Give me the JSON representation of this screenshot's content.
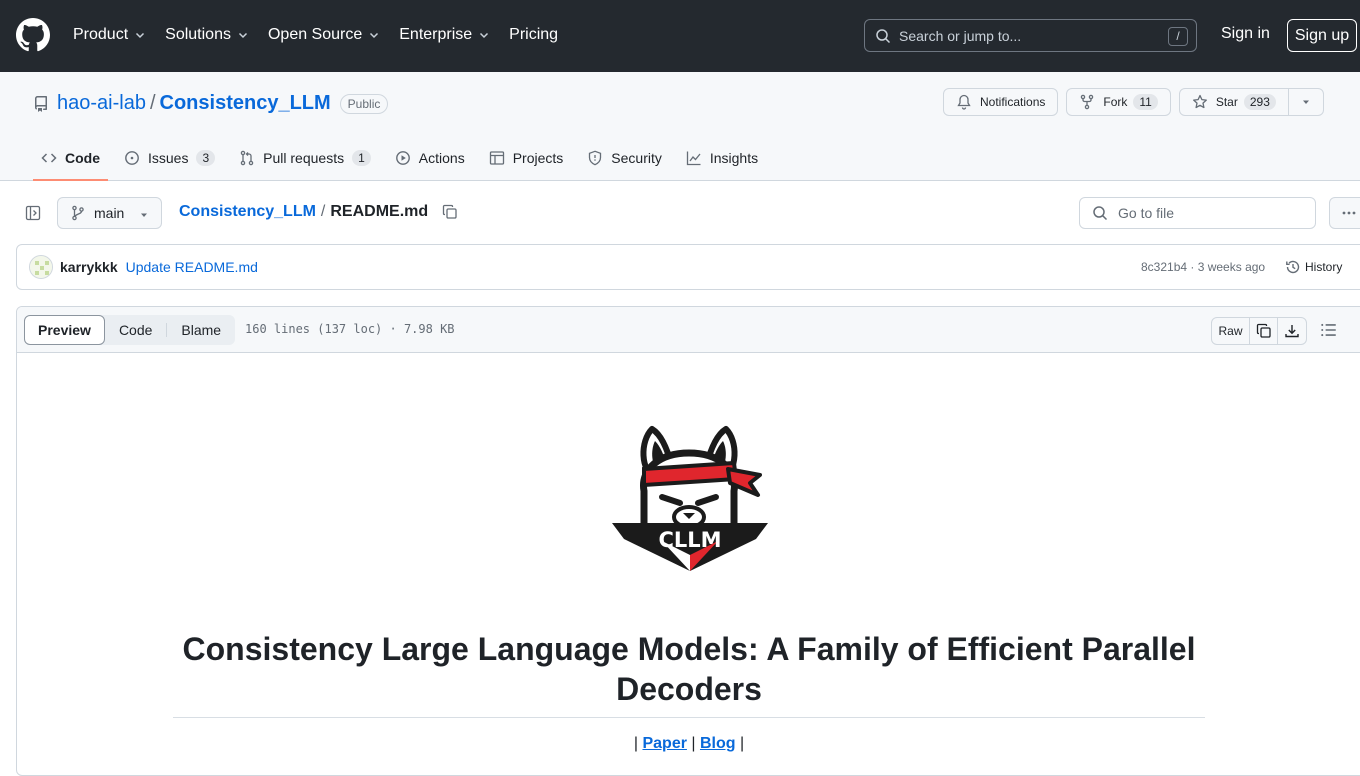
{
  "header": {
    "nav": [
      {
        "label": "Product",
        "dropdown": true
      },
      {
        "label": "Solutions",
        "dropdown": true
      },
      {
        "label": "Open Source",
        "dropdown": true
      },
      {
        "label": "Enterprise",
        "dropdown": true
      },
      {
        "label": "Pricing",
        "dropdown": false
      }
    ],
    "search_placeholder": "Search or jump to...",
    "search_shortcut": "/",
    "sign_in": "Sign in",
    "sign_up": "Sign up"
  },
  "repo": {
    "owner": "hao-ai-lab",
    "separator": "/",
    "name": "Consistency_LLM",
    "visibility": "Public",
    "notifications_label": "Notifications",
    "fork_label": "Fork",
    "fork_count": "11",
    "star_label": "Star",
    "star_count": "293"
  },
  "tabs": [
    {
      "label": "Code",
      "icon": "code-icon",
      "active": true
    },
    {
      "label": "Issues",
      "icon": "issue-icon",
      "count": "3"
    },
    {
      "label": "Pull requests",
      "icon": "pull-request-icon",
      "count": "1"
    },
    {
      "label": "Actions",
      "icon": "play-icon"
    },
    {
      "label": "Projects",
      "icon": "table-icon"
    },
    {
      "label": "Security",
      "icon": "shield-icon"
    },
    {
      "label": "Insights",
      "icon": "graph-icon"
    }
  ],
  "file_nav": {
    "branch": "main",
    "crumb_repo": "Consistency_LLM",
    "crumb_sep": "/",
    "crumb_file": "README.md",
    "goto_placeholder": "Go to file"
  },
  "commit": {
    "author": "karrykkk",
    "message": "Update README.md",
    "meta": "8c321b4 · 3 weeks ago",
    "history": "History"
  },
  "viewer": {
    "modes": [
      "Preview",
      "Code",
      "Blame"
    ],
    "active_mode": "Preview",
    "info": "160 lines (137 loc) · 7.98 KB",
    "raw": "Raw"
  },
  "readme": {
    "logo_text": "CLLM",
    "title": "Consistency Large Language Models: A Family of Efficient Parallel Decoders",
    "links_prefix": "| ",
    "link_paper": "Paper",
    "links_mid": " | ",
    "link_blog": "Blog",
    "links_suffix": " |"
  },
  "colors": {
    "header_bg": "#24292f",
    "link": "#0969da",
    "tab_underline": "#fd8c73",
    "logo_red": "#e0262d"
  }
}
